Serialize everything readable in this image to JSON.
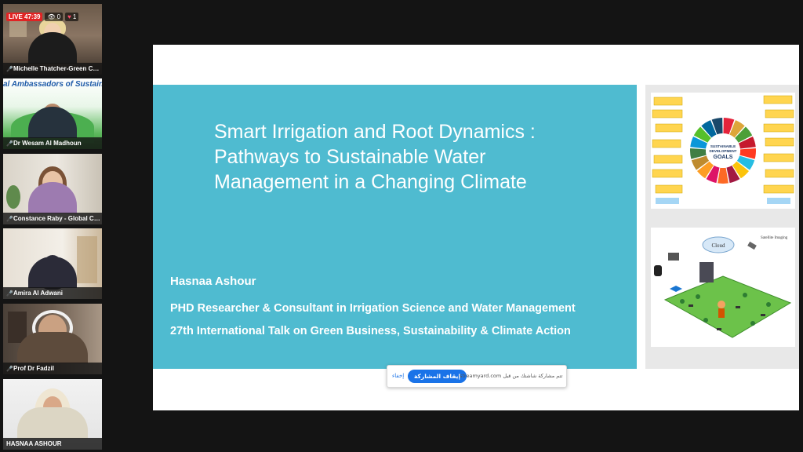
{
  "stream": {
    "live_label": "LIVE 47:39",
    "viewers": "0",
    "likes": "1"
  },
  "participants": [
    {
      "name": "Michelle Thatcher-Green Ch..."
    },
    {
      "name": "Dr Wesam Al Madhoun",
      "banner_text": "al Ambassadors of Sustainab"
    },
    {
      "name": "Constance Raby - Global Climat..."
    },
    {
      "name": "Amira Al Adwani"
    },
    {
      "name": "Prof Dr Fadzil"
    },
    {
      "name": "HASNAA ASHOUR"
    }
  ],
  "slide": {
    "title_lines": [
      "Smart Irrigation and Root Dynamics :",
      "Pathways to Sustainable Water",
      "Management in a Changing Climate"
    ],
    "author": "Hasnaa Ashour",
    "role": "PHD Researcher & Consultant in Irrigation Science and Water Management",
    "event": "27th International Talk on Green Business, Sustainability & Climate Action",
    "sdg_label_1": "SUSTAINABLE",
    "sdg_label_2": "DEVELOPMENT",
    "sdg_label_3": "GOALS",
    "diagram_cloud": "Cloud",
    "diagram_satellite": "Satellite Imaging"
  },
  "share_bar": {
    "message": "تتم مشاركة شاشتك من قبل streamyard.com",
    "stop_label": "إيقاف المشاركة",
    "hide_label": "إخفاء"
  },
  "colors": {
    "slide_panel": "#4fbbd0",
    "live_red": "#e02424",
    "share_blue": "#1a73e8"
  }
}
